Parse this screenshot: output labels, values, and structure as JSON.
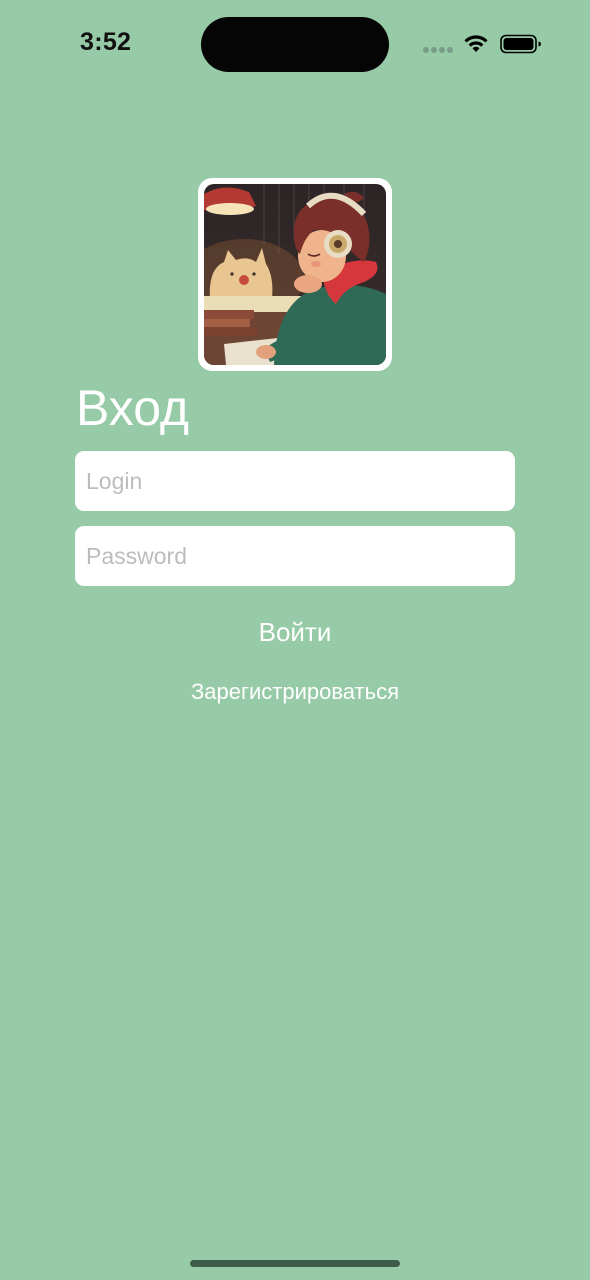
{
  "status_bar": {
    "time": "3:52"
  },
  "login_screen": {
    "title": "Вход",
    "login_placeholder": "Login",
    "login_value": "",
    "password_placeholder": "Password",
    "password_value": "",
    "login_button_label": "Войти",
    "register_button_label": "Зарегистрироваться"
  },
  "icons": {
    "wifi": "wifi-icon",
    "battery": "battery-icon",
    "signal": "cellular-signal-icon"
  },
  "colors": {
    "background": "#97CAA6",
    "text_light": "#FFFFFF",
    "field_background": "#FFFFFF",
    "placeholder": "#BCBCBC"
  }
}
